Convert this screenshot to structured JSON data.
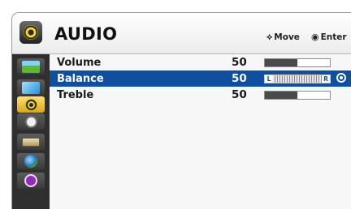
{
  "header": {
    "title": "AUDIO",
    "move_hint": "Move",
    "enter_hint": "Enter",
    "move_glyph": "⟡",
    "enter_glyph": "◉",
    "icon": "speaker-icon"
  },
  "sidebar": {
    "items": [
      {
        "name": "picture",
        "icon": "picture-icon",
        "active": false
      },
      {
        "name": "screen",
        "icon": "screen-icon",
        "active": false
      },
      {
        "name": "audio",
        "icon": "speaker-icon",
        "active": true
      },
      {
        "name": "time",
        "icon": "clock-icon",
        "active": false
      },
      {
        "name": "setup",
        "icon": "toolbox-icon",
        "active": false
      },
      {
        "name": "network",
        "icon": "globe-icon",
        "active": false
      },
      {
        "name": "info",
        "icon": "info-icon",
        "active": false
      }
    ]
  },
  "menu": {
    "items": [
      {
        "label": "Volume",
        "value": "50",
        "level": 0.5,
        "selected": false
      },
      {
        "label": "Balance",
        "value": "50",
        "left_cap": "L",
        "right_cap": "R",
        "selected": true
      },
      {
        "label": "Treble",
        "value": "50",
        "level": 0.5,
        "selected": false
      }
    ]
  },
  "colors": {
    "selected_row": "#0f4f9e",
    "sidebar_bg": "#2f2f2f",
    "active_tab": "#f0c419"
  }
}
